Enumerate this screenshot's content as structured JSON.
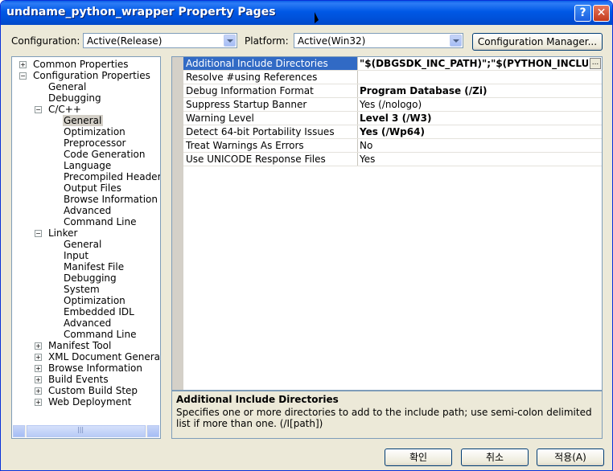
{
  "window": {
    "title": "undname_python_wrapper Property Pages",
    "help_glyph": "?",
    "close_glyph": "✕"
  },
  "toolbar": {
    "configuration_label": "Configuration:",
    "configuration_value": "Active(Release)",
    "platform_label": "Platform:",
    "platform_value": "Active(Win32)",
    "config_manager_label": "Configuration Manager..."
  },
  "tree": {
    "items": [
      {
        "label": "Common Properties",
        "expander": "+"
      },
      {
        "label": "Configuration Properties",
        "expander": "−"
      },
      {
        "label": "General"
      },
      {
        "label": "Debugging"
      },
      {
        "label": "C/C++",
        "expander": "−"
      },
      {
        "label": "General",
        "selected": true
      },
      {
        "label": "Optimization"
      },
      {
        "label": "Preprocessor"
      },
      {
        "label": "Code Generation"
      },
      {
        "label": "Language"
      },
      {
        "label": "Precompiled Headers"
      },
      {
        "label": "Output Files"
      },
      {
        "label": "Browse Information"
      },
      {
        "label": "Advanced"
      },
      {
        "label": "Command Line"
      },
      {
        "label": "Linker",
        "expander": "−"
      },
      {
        "label": "General"
      },
      {
        "label": "Input"
      },
      {
        "label": "Manifest File"
      },
      {
        "label": "Debugging"
      },
      {
        "label": "System"
      },
      {
        "label": "Optimization"
      },
      {
        "label": "Embedded IDL"
      },
      {
        "label": "Advanced"
      },
      {
        "label": "Command Line"
      },
      {
        "label": "Manifest Tool",
        "expander": "+"
      },
      {
        "label": "XML Document Generator",
        "expander": "+"
      },
      {
        "label": "Browse Information",
        "expander": "+"
      },
      {
        "label": "Build Events",
        "expander": "+"
      },
      {
        "label": "Custom Build Step",
        "expander": "+"
      },
      {
        "label": "Web Deployment",
        "expander": "+"
      }
    ],
    "scroll_grip": "|||"
  },
  "properties": {
    "rows": [
      {
        "name": "Additional Include Directories",
        "value": "\"$(DBGSDK_INC_PATH)\";\"$(PYTHON_INCLUDE)\"",
        "bold": true,
        "selected": true
      },
      {
        "name": "Resolve #using References",
        "value": "",
        "bold": false
      },
      {
        "name": "Debug Information Format",
        "value": "Program Database (/Zi)",
        "bold": true
      },
      {
        "name": "Suppress Startup Banner",
        "value": "Yes (/nologo)",
        "bold": false
      },
      {
        "name": "Warning Level",
        "value": "Level 3 (/W3)",
        "bold": true
      },
      {
        "name": "Detect 64-bit Portability Issues",
        "value": "Yes (/Wp64)",
        "bold": true
      },
      {
        "name": "Treat Warnings As Errors",
        "value": "No",
        "bold": false
      },
      {
        "name": "Use UNICODE Response Files",
        "value": "Yes",
        "bold": false
      }
    ],
    "ellipsis_label": "..."
  },
  "description": {
    "title": "Additional Include Directories",
    "text": "Specifies one or more directories to add to the include path; use semi-colon delimited list if more than one.     (/I[path])"
  },
  "buttons": {
    "ok": "확인",
    "cancel": "취소",
    "apply": "적용(A)"
  }
}
